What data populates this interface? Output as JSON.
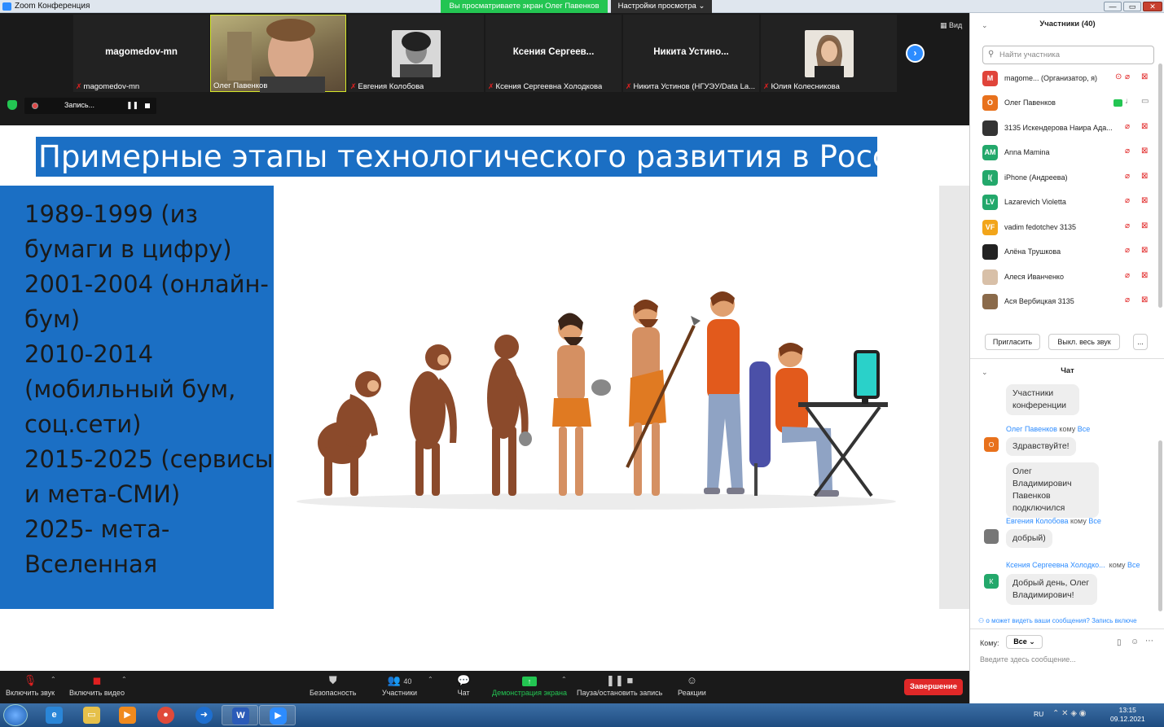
{
  "window": {
    "title": "Zoom Конференция",
    "viewing_banner": "Вы просматриваете экран Олег Павенков",
    "view_options": "Настройки просмотра",
    "minimize": "—",
    "maximize": "▭",
    "close": "✕"
  },
  "strip": {
    "view_label": "Вид",
    "tiles": [
      {
        "name": "magomedov-mn",
        "label": "magomedov-mn"
      },
      {
        "name": "",
        "label": "Олег Павенков"
      },
      {
        "name": "",
        "label": "Евгения Колобова"
      },
      {
        "name": "Ксения Сергеев...",
        "label": "Ксения Сергеевна Холодкова"
      },
      {
        "name": "Никита Устино...",
        "label": "Никита Устинов (НГУЭУ/Data La..."
      },
      {
        "name": "",
        "label": "Юлия Колесникова"
      }
    ],
    "record_label": "Запись...",
    "pause_label": "❚❚"
  },
  "slide": {
    "title": "Примерные этапы технологического развития в России",
    "lines": [
      "1989-1999 (из",
      "бумаги в цифру)",
      "2001-2004 (онлайн-",
      "бум)",
      "2010-2014",
      "(мобильный бум,",
      "соц.сети)",
      "2015-2025 (сервисы",
      "и мета-СМИ)",
      "2025- мета-",
      "Вселенная"
    ]
  },
  "toolbar": {
    "audio": "Включить звук",
    "video": "Включить видео",
    "security": "Безопасность",
    "participants": "Участники",
    "participants_count": "40",
    "chat": "Чат",
    "share": "Демонстрация экрана",
    "record": "Пауза/остановить запись",
    "reactions": "Реакции",
    "end": "Завершение"
  },
  "participants_panel": {
    "header": "Участники (40)",
    "search_placeholder": "Найти участника",
    "items": [
      {
        "initials": "M",
        "name": "magome...  (Организатор, я)",
        "color": "#e0443a"
      },
      {
        "initials": "О",
        "name": "Олег Павенков",
        "color": "#e8711c"
      },
      {
        "initials": "",
        "name": "3135 Искендерова Наира Ада...",
        "color": "#333333"
      },
      {
        "initials": "AM",
        "name": "Anna Mamina",
        "color": "#23a86b"
      },
      {
        "initials": "I(",
        "name": "iPhone (Андреева)",
        "color": "#23a86b"
      },
      {
        "initials": "LV",
        "name": "Lazarevich Violetta",
        "color": "#23a86b"
      },
      {
        "initials": "VF",
        "name": "vadim fedotchev 3135",
        "color": "#f2a51a"
      },
      {
        "initials": "",
        "name": "Алёна Трушкова",
        "color": "#222222"
      },
      {
        "initials": "",
        "name": "Алеся Иванченко",
        "color": "#d8c0a8"
      },
      {
        "initials": "",
        "name": "Ася Вербицкая 3135",
        "color": "#8a6a4a"
      }
    ],
    "invite": "Пригласить",
    "mute_all": "Выкл. весь звук",
    "more": "..."
  },
  "chat": {
    "header": "Чат",
    "messages": [
      {
        "sender": "",
        "to": "",
        "text": "Участники конференции",
        "initial": ""
      },
      {
        "sender": "Олег Павенков",
        "to_word": "кому",
        "to": "Все",
        "text": "Здравствуйте!",
        "initial": "О",
        "color": "#e8711c"
      },
      {
        "sender": "",
        "to": "",
        "text": "Олег Владимирович Павенков подключился",
        "initial": ""
      },
      {
        "sender": "Евгения Колобова",
        "to_word": "кому",
        "to": "Все",
        "text": "добрый)",
        "initial": "",
        "color": "#777777"
      },
      {
        "sender": "Ксения Сергеевна Холодко...",
        "to_word": "кому",
        "to": "Все",
        "text": "Добрый день, Олег Владимирович!",
        "initial": "К",
        "color": "#23a86b"
      }
    ],
    "notice": "о может видеть ваши сообщения? Запись включе",
    "to_label": "Кому:",
    "to_value": "Все",
    "input_placeholder": "Введите здесь сообщение..."
  },
  "taskbar": {
    "lang": "RU",
    "time": "13:15",
    "date": "09.12.2021"
  }
}
